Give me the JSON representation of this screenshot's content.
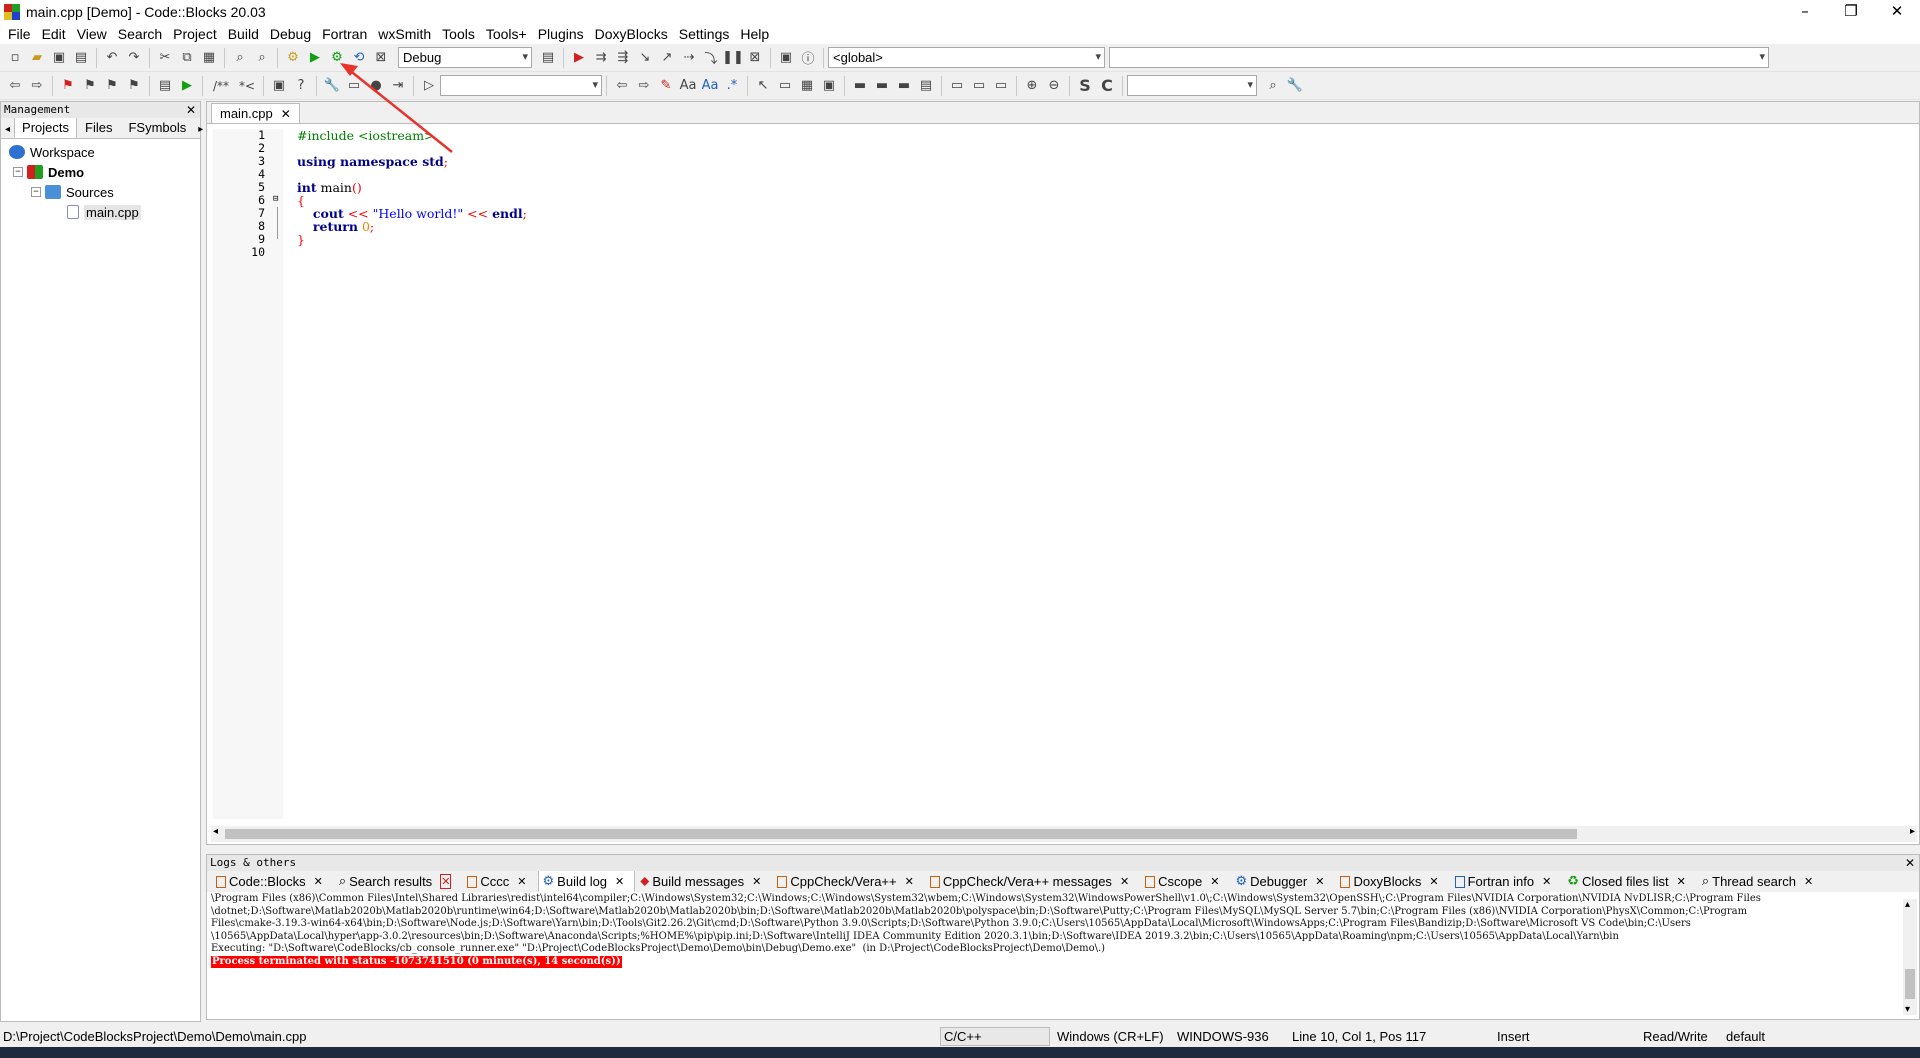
{
  "window": {
    "title": "main.cpp [Demo] - Code::Blocks 20.03",
    "minimize": "–",
    "maximize": "❐",
    "close": "✕"
  },
  "menu": [
    "File",
    "Edit",
    "View",
    "Search",
    "Project",
    "Build",
    "Debug",
    "Fortran",
    "wxSmith",
    "Tools",
    "Tools+",
    "Plugins",
    "DoxyBlocks",
    "Settings",
    "Help"
  ],
  "toolbar": {
    "build_target": "Debug",
    "scope": "<global>",
    "symbol": ""
  },
  "management": {
    "title": "Management",
    "tabs": [
      "Projects",
      "Files",
      "FSymbols"
    ],
    "tree": {
      "workspace": "Workspace",
      "project": "Demo",
      "folder": "Sources",
      "file": "main.cpp"
    }
  },
  "editor": {
    "tab": "main.cpp",
    "line_numbers": [
      "1",
      "2",
      "3",
      "4",
      "5",
      "6",
      "7",
      "8",
      "9",
      "10"
    ]
  },
  "logs": {
    "title": "Logs & others",
    "tabs": [
      "Code::Blocks",
      "Search results",
      "Cccc",
      "Build log",
      "Build messages",
      "CppCheck/Vera++",
      "CppCheck/Vera++ messages",
      "Cscope",
      "Debugger",
      "DoxyBlocks",
      "Fortran info",
      "Closed files list",
      "Thread search"
    ],
    "lines": [
      "\\Program Files (x86)\\Common Files\\Intel\\Shared Libraries\\redist\\intel64\\compiler;C:\\Windows\\System32;C:\\Windows;C:\\Windows\\System32\\wbem;C:\\Windows\\System32\\WindowsPowerShell\\v1.0\\;C:\\Windows\\System32\\OpenSSH\\;C:\\Program Files\\NVIDIA Corporation\\NVIDIA NvDLISR;C:\\Program Files",
      "\\dotnet;D:\\Software\\Matlab2020b\\Matlab2020b\\runtime\\win64;D:\\Software\\Matlab2020b\\Matlab2020b\\bin;D:\\Software\\Matlab2020b\\Matlab2020b\\polyspace\\bin;D:\\Software\\Putty;C:\\Program Files\\MySQL\\MySQL Server 5.7\\bin;C:\\Program Files (x86)\\NVIDIA Corporation\\PhysX\\Common;C:\\Program",
      "Files\\cmake-3.19.3-win64-x64\\bin;D:\\Software\\Node.js;D:\\Software\\Yarn\\bin;D:\\Tools\\Git2.26.2\\Git\\cmd;D:\\Software\\Python 3.9.0\\Scripts;D:\\Software\\Python 3.9.0;C:\\Users\\10565\\AppData\\Local\\Microsoft\\WindowsApps;C:\\Program Files\\Bandizip;D:\\Software\\Microsoft VS Code\\bin;C:\\Users",
      "\\10565\\AppData\\Local\\hyper\\app-3.0.2\\resources\\bin;D:\\Software\\Anaconda\\Scripts;%HOME%\\pip\\pip.ini;D:\\Software\\IntelliJ IDEA Community Edition 2020.3.1\\bin;D:\\Software\\IDEA 2019.3.2\\bin;C:\\Users\\10565\\AppData\\Roaming\\npm;C:\\Users\\10565\\AppData\\Local\\Yarn\\bin",
      "Executing: \"D:\\Software\\CodeBlocks/cb_console_runner.exe\" \"D:\\Project\\CodeBlocksProject\\Demo\\Demo\\bin\\Debug\\Demo.exe\"  (in D:\\Project\\CodeBlocksProject\\Demo\\Demo\\.)"
    ],
    "error": "Process terminated with status -1073741510 (0 minute(s), 14 second(s))"
  },
  "status": {
    "path": "D:\\Project\\CodeBlocksProject\\Demo\\Demo\\main.cpp",
    "lang": "C/C++",
    "eol": "Windows (CR+LF)",
    "encoding": "WINDOWS-936",
    "position": "Line 10, Col 1, Pos 117",
    "mode": "Insert",
    "access": "Read/Write",
    "profile": "default"
  },
  "colors": {
    "annotation_arrow": "#e8322c",
    "error_bg": "#ff0000"
  }
}
